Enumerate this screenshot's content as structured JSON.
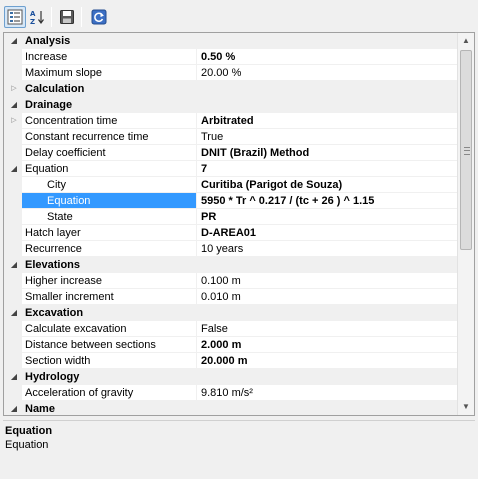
{
  "toolbar": {
    "buttons": [
      {
        "name": "categorized-view-button",
        "icon": "categorized-icon"
      },
      {
        "name": "alphabetical-view-button",
        "icon": "sort-az-icon"
      },
      {
        "name": "save-button",
        "icon": "floppy-disk-icon"
      },
      {
        "name": "refresh-button",
        "icon": "refresh-icon"
      }
    ]
  },
  "grid": {
    "rows": [
      {
        "type": "category",
        "label": "Analysis",
        "expanded": true
      },
      {
        "type": "prop",
        "label": "Increase",
        "value": "0.50 %",
        "bold": true
      },
      {
        "type": "prop",
        "label": "Maximum slope",
        "value": "20.00 %"
      },
      {
        "type": "category",
        "label": "Calculation",
        "expanded": false
      },
      {
        "type": "category",
        "label": "Drainage",
        "expanded": true
      },
      {
        "type": "prop",
        "label": "Concentration time",
        "value": "Arbitrated",
        "bold": true,
        "collapsed_glyph": true
      },
      {
        "type": "prop",
        "label": "Constant recurrence time",
        "value": "True"
      },
      {
        "type": "prop",
        "label": "Delay coefficient",
        "value": "DNIT (Brazil) Method",
        "bold": true
      },
      {
        "type": "prop",
        "label": "Equation",
        "value": "7",
        "bold": true,
        "expanded_glyph": true
      },
      {
        "type": "sub",
        "label": "City",
        "value": "Curitiba (Parigot de Souza)",
        "bold": true
      },
      {
        "type": "sub",
        "label": "Equation",
        "value": "5950 * Tr ^ 0.217 / (tc + 26 ) ^ 1.15",
        "bold": true,
        "selected": true
      },
      {
        "type": "sub",
        "label": "State",
        "value": "PR",
        "bold": true
      },
      {
        "type": "prop",
        "label": "Hatch layer",
        "value": "D-AREA01",
        "bold": true
      },
      {
        "type": "prop",
        "label": "Recurrence",
        "value": "10 years"
      },
      {
        "type": "category",
        "label": "Elevations",
        "expanded": true
      },
      {
        "type": "prop",
        "label": "Higher increase",
        "value": "0.100 m"
      },
      {
        "type": "prop",
        "label": "Smaller increment",
        "value": "0.010 m"
      },
      {
        "type": "category",
        "label": "Excavation",
        "expanded": true
      },
      {
        "type": "prop",
        "label": "Calculate excavation",
        "value": "False"
      },
      {
        "type": "prop",
        "label": "Distance between sections",
        "value": "2.000 m",
        "bold": true
      },
      {
        "type": "prop",
        "label": "Section width",
        "value": "20.000 m",
        "bold": true
      },
      {
        "type": "category",
        "label": "Hydrology",
        "expanded": true
      },
      {
        "type": "prop",
        "label": "Acceleration of gravity",
        "value": "9.810 m/s²"
      },
      {
        "type": "category",
        "label": "Name",
        "expanded": true
      }
    ]
  },
  "help": {
    "title": "Equation",
    "description": "Equation"
  }
}
